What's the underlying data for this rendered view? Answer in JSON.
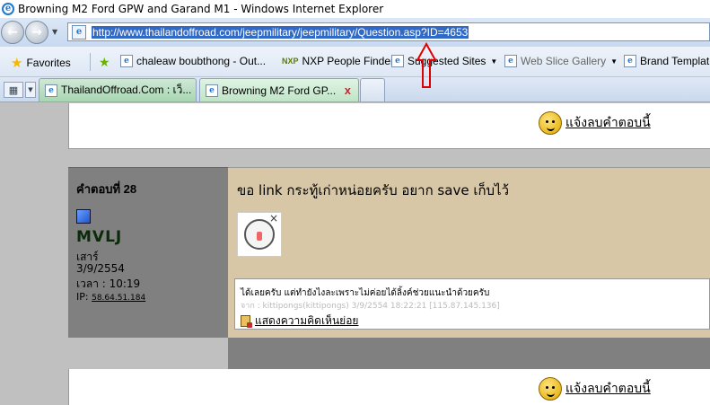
{
  "window": {
    "title": "Browning M2 Ford GPW and Garand M1 - Windows Internet Explorer"
  },
  "address_bar": {
    "url": "http://www.thailandoffroad.com/jeepmilitary/jeepmilitary/Question.asp?ID=4653"
  },
  "favorites_bar": {
    "favorites_label": "Favorites",
    "items": [
      "chaleaw boubthong - Out...",
      "NXP People Finder",
      "Suggested Sites",
      "Web Slice Gallery",
      "Brand Templat"
    ]
  },
  "tabs": [
    {
      "label": "ThailandOffroad.Com : เว็..."
    },
    {
      "label": "Browning M2 Ford GP..."
    }
  ],
  "page": {
    "report_link": "แจ้งลบคำตอบนี้",
    "reply": {
      "label": "คำตอบที่ 28",
      "username": "MVLJ",
      "day": "เสาร์",
      "date": "3/9/2554",
      "time": "เวลา : 10:19",
      "ip_label": "IP:",
      "ip": "58.64.51.184",
      "text": "ขอ link กระทู้เก่าหน่อยครับ อยาก save เก็บไว้"
    },
    "comment": {
      "text": "ได้เลยครับ แต่ทำยังไงละเพราะไม่ค่อยได้ลิ้งค์ช่วยแนะนำด้วยครับ",
      "meta": "จาก : kittipongs(kittipongs) 3/9/2554 18:22:21 [115.87.145.136]",
      "show_all": "แสดงความคิดเห็นย่อย"
    }
  },
  "colors": {
    "url_highlight": "#3169c6",
    "post_background": "#d7c7a6",
    "sidebar_background": "#808080",
    "annotation_arrow": "#e00000"
  }
}
